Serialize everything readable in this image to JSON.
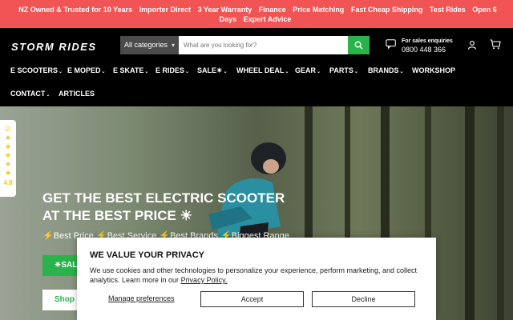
{
  "promo": {
    "items": [
      "NZ Owned & Trusted for 10 Years",
      "Importer Direct",
      "3 Year Warranty",
      "Finance",
      "Price Matching",
      "Fast Cheap Shipping",
      "Test Rides",
      "Open 6 Days",
      "Expert Advice"
    ]
  },
  "header": {
    "logo": "STORM RIDES",
    "search_category": "All categories",
    "search_placeholder": "What are you looking for?",
    "sales_label": "For sales enquiries",
    "sales_phone": "0800 448 366",
    "icons": [
      "search-icon",
      "chat-phone-icon",
      "user-icon",
      "cart-icon"
    ]
  },
  "nav": {
    "items": [
      "E SCOOTERS",
      "E MOPED",
      "E SKATE",
      "E RIDES",
      "SALE✴",
      "WHEEL DEAL",
      "GEAR",
      "PARTS",
      "BRANDS",
      "WORKSHOP",
      "CONTACT",
      "ARTICLES"
    ]
  },
  "rating": {
    "value": "4.8"
  },
  "hero": {
    "headline_1": "GET THE BEST ELECTRIC SCOOTER",
    "headline_2": "AT THE BEST PRICE ☀",
    "subline": "⚡Best Price ⚡Best Service ⚡Best Brands ⚡Biggest Range",
    "button_sale": "✴SALE",
    "button_shop": "Shop All"
  },
  "cookie": {
    "title": "WE VALUE YOUR PRIVACY",
    "text": "We use cookies and other technologies to personalize your experience, perform marketing, and collect analytics. Learn more in our ",
    "link": "Privacy Policy.",
    "manage": "Manage preferences",
    "accept": "Accept",
    "decline": "Decline"
  },
  "colors": {
    "promo_bg": "#f05454",
    "accent_green": "#29b34a",
    "star": "#f5c518"
  }
}
